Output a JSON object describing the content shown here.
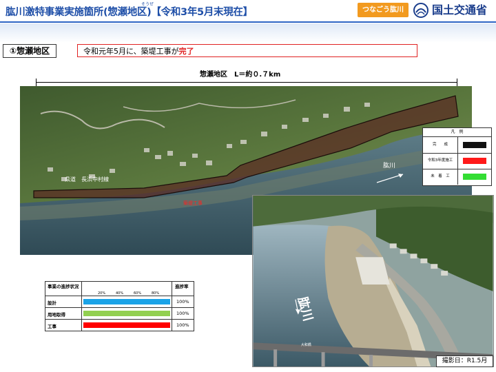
{
  "header": {
    "title": "肱川激特事業実施箇所(惣瀬地区)【令和3年5月末現在】",
    "ruby": "そうぜ",
    "badge_label": "つなごう肱川",
    "ministry_name": "国土交通省"
  },
  "section": {
    "label": "①惣瀬地区",
    "status_prefix": "令和元年5月に、築堤工事が",
    "status_done": "完了"
  },
  "map": {
    "length_label": "惣瀬地区　L＝約０.７km",
    "river_label": "肱川",
    "road_label": "県道　長浜中村線",
    "levee_label": "築堤工事"
  },
  "legend": {
    "title": "凡　例",
    "items": [
      {
        "label": "完　　成",
        "color": "#111111"
      },
      {
        "label": "令和3年度施工",
        "color": "#ff1a1a"
      },
      {
        "label": "未　着　工",
        "color": "#33dd33"
      }
    ]
  },
  "photo": {
    "river_label": "肱川",
    "bridge_label": "大和橋",
    "date_label": "撮影日：R1.5月"
  },
  "progress": {
    "header": "事業の進捗状況",
    "rate_header": "進捗率",
    "ticks": [
      "20%",
      "40%",
      "60%",
      "80%"
    ],
    "rows": [
      {
        "label": "設計",
        "value": 100,
        "display": "100%",
        "color": "#1aa3e8"
      },
      {
        "label": "用地取得",
        "value": 100,
        "display": "100%",
        "color": "#92d050"
      },
      {
        "label": "工事",
        "value": 100,
        "display": "100%",
        "color": "#ff0000"
      }
    ]
  }
}
